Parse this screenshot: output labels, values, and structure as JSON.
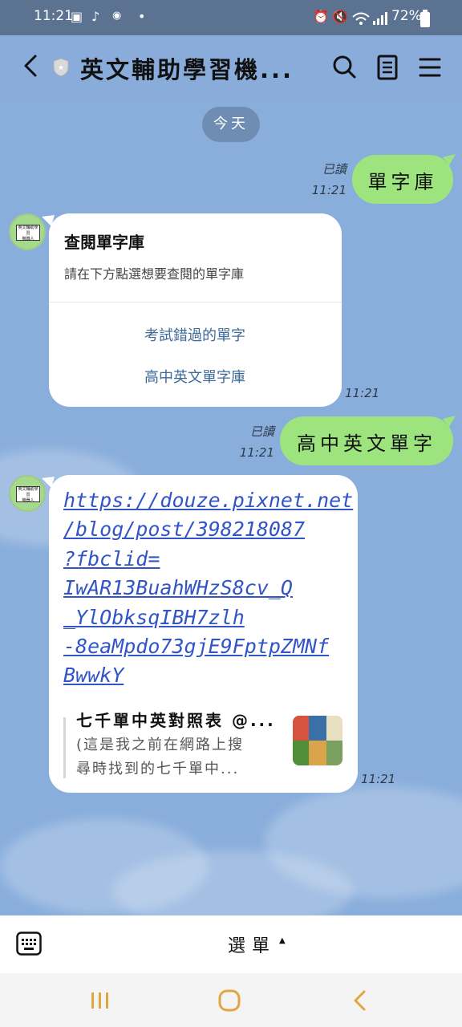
{
  "status_bar": {
    "time": "11:21",
    "battery": "72%"
  },
  "header": {
    "title": "英文輔助學習機..."
  },
  "chat": {
    "date_chip": "今天",
    "messages": {
      "m1": {
        "read": "已讀",
        "time": "11:21",
        "text": "單字庫"
      },
      "m2": {
        "title": "查閱單字庫",
        "subtitle": "請在下方點選想要查閱的單字庫",
        "options": [
          "考試錯過的單字",
          "高中英文單字庫"
        ],
        "time": "11:21"
      },
      "m3": {
        "read": "已讀",
        "time": "11:21",
        "text": "高中英文單字"
      },
      "m4": {
        "url_lines": [
          "https://douze.pixnet.net",
          "/blog/post/398218087",
          "?fbclid=",
          "IwAR13BuahWHzS8cv_Q",
          "_YlObksqIBH7zlh",
          "-8eaMpdo73gjE9FptpZMNf",
          "BwwkY"
        ],
        "preview_title": "七千單中英對照表 @...",
        "preview_desc_1": "(這是我之前在網路上搜",
        "preview_desc_2": "尋時找到的七千單中...",
        "time": "11:21"
      }
    }
  },
  "bottom_bar": {
    "menu_label": "選單"
  },
  "colors": {
    "chat_bg": "#8aaedc",
    "green_bubble": "#9de47f",
    "link": "#3155c7"
  }
}
